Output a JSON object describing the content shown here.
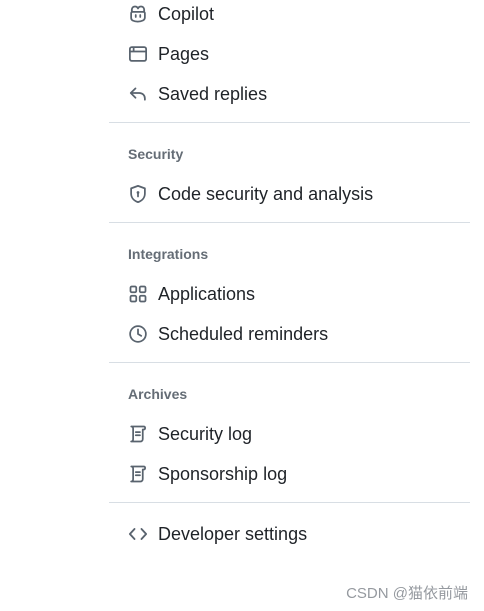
{
  "nav": {
    "top_items": [
      {
        "label": "Copilot",
        "icon": "copilot-icon"
      },
      {
        "label": "Pages",
        "icon": "browser-icon"
      },
      {
        "label": "Saved replies",
        "icon": "reply-icon"
      }
    ],
    "security": {
      "heading": "Security",
      "items": [
        {
          "label": "Code security and analysis",
          "icon": "shield-lock-icon"
        }
      ]
    },
    "integrations": {
      "heading": "Integrations",
      "items": [
        {
          "label": "Applications",
          "icon": "apps-icon"
        },
        {
          "label": "Scheduled reminders",
          "icon": "clock-icon"
        }
      ]
    },
    "archives": {
      "heading": "Archives",
      "items": [
        {
          "label": "Security log",
          "icon": "log-icon"
        },
        {
          "label": "Sponsorship log",
          "icon": "log-icon"
        }
      ]
    },
    "developer": {
      "label": "Developer settings",
      "icon": "code-icon"
    }
  },
  "watermark": "CSDN @猫依前端",
  "colors": {
    "text": "#1f2328",
    "muted": "#656d76",
    "divider": "#d8dee4",
    "icon": "#59636e"
  }
}
